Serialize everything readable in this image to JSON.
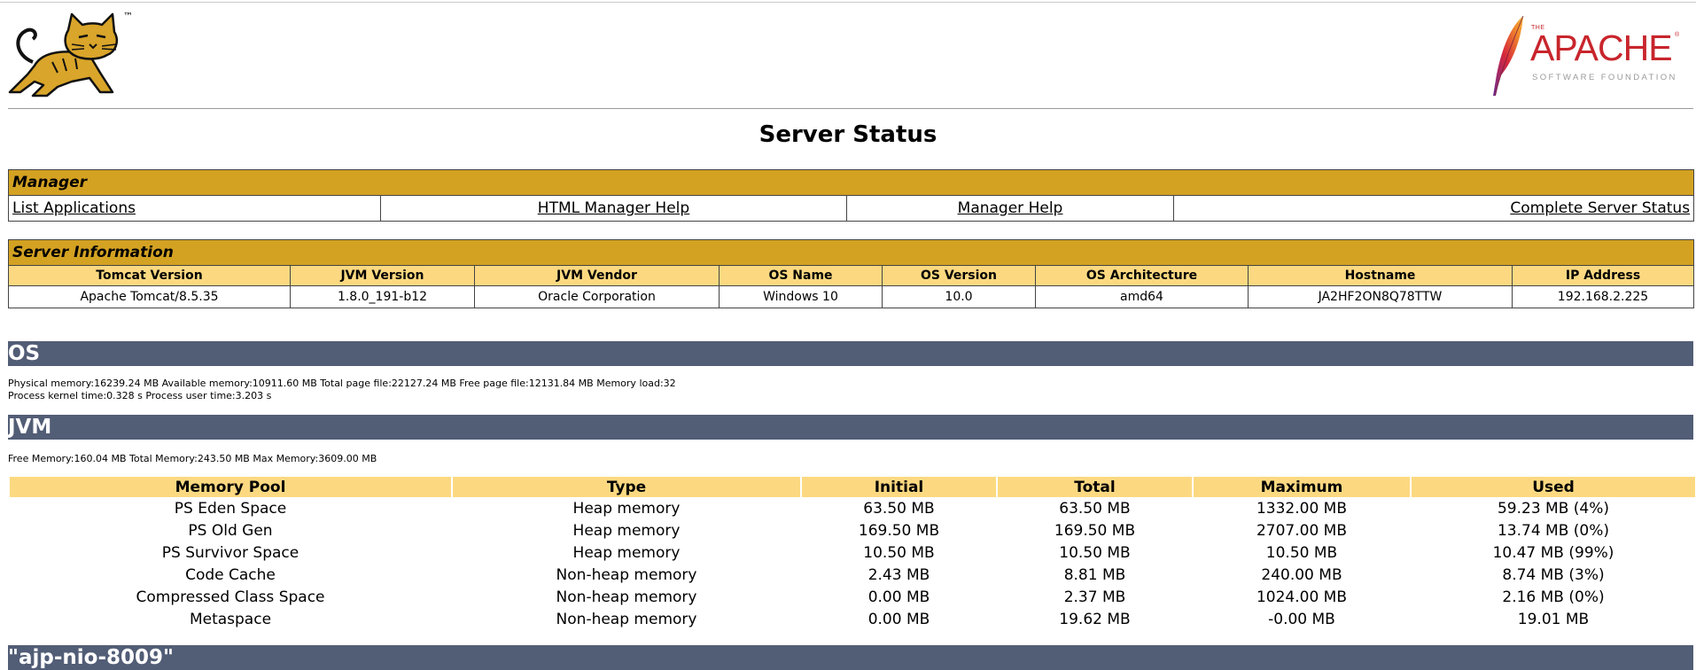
{
  "header": {
    "tomcat_tm": "™",
    "apache_the": "THE",
    "apache_word": "APACHE",
    "apache_reg": "®",
    "apache_sub": "SOFTWARE FOUNDATION"
  },
  "page_title": "Server Status",
  "manager": {
    "title": "Manager",
    "links": [
      "List Applications",
      "HTML Manager Help",
      "Manager Help",
      "Complete Server Status"
    ]
  },
  "server_info": {
    "title": "Server Information",
    "headers": [
      "Tomcat Version",
      "JVM Version",
      "JVM Vendor",
      "OS Name",
      "OS Version",
      "OS Architecture",
      "Hostname",
      "IP Address"
    ],
    "values": [
      "Apache Tomcat/8.5.35",
      "1.8.0_191-b12",
      "Oracle Corporation",
      "Windows 10",
      "10.0",
      "amd64",
      "JA2HF2ON8Q78TTW",
      "192.168.2.225"
    ]
  },
  "os": {
    "title": "OS",
    "line1": "Physical memory:16239.24 MB Available memory:10911.60 MB Total page file:22127.24 MB Free page file:12131.84 MB Memory load:32",
    "line2": "Process kernel time:0.328 s Process user time:3.203 s"
  },
  "jvm": {
    "title": "JVM",
    "summary": "Free Memory:160.04 MB Total Memory:243.50 MB Max Memory:3609.00 MB",
    "headers": [
      "Memory Pool",
      "Type",
      "Initial",
      "Total",
      "Maximum",
      "Used"
    ],
    "rows": [
      [
        "PS Eden Space",
        "Heap memory",
        "63.50 MB",
        "63.50 MB",
        "1332.00 MB",
        "59.23 MB (4%)"
      ],
      [
        "PS Old Gen",
        "Heap memory",
        "169.50 MB",
        "169.50 MB",
        "2707.00 MB",
        "13.74 MB (0%)"
      ],
      [
        "PS Survivor Space",
        "Heap memory",
        "10.50 MB",
        "10.50 MB",
        "10.50 MB",
        "10.47 MB (99%)"
      ],
      [
        "Code Cache",
        "Non-heap memory",
        "2.43 MB",
        "8.81 MB",
        "240.00 MB",
        "8.74 MB (3%)"
      ],
      [
        "Compressed Class Space",
        "Non-heap memory",
        "0.00 MB",
        "2.37 MB",
        "1024.00 MB",
        "2.16 MB (0%)"
      ],
      [
        "Metaspace",
        "Non-heap memory",
        "0.00 MB",
        "19.62 MB",
        "-0.00 MB",
        "19.01 MB"
      ]
    ]
  },
  "connector": {
    "title": "\"ajp-nio-8009\""
  },
  "colors": {
    "gold_title": "#d4a222",
    "gold_header": "#fcd981",
    "section_bar": "#525d76",
    "apache_red": "#c8252c"
  }
}
